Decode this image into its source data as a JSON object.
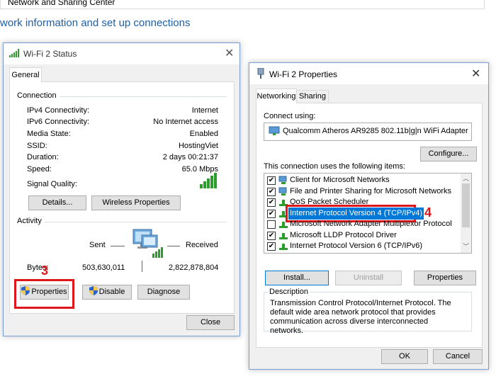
{
  "bg": {
    "breadcrumb": "Network and Sharing Center",
    "heading": "work information and set up connections"
  },
  "status_dialog": {
    "title": "Wi-Fi 2 Status",
    "tab_general": "General",
    "connection_label": "Connection",
    "rows": [
      {
        "label": "IPv4 Connectivity:",
        "value": "Internet"
      },
      {
        "label": "IPv6 Connectivity:",
        "value": "No Internet access"
      },
      {
        "label": "Media State:",
        "value": "Enabled"
      },
      {
        "label": "SSID:",
        "value": "HostingViet"
      },
      {
        "label": "Duration:",
        "value": "2 days 00:21:37"
      },
      {
        "label": "Speed:",
        "value": "65.0 Mbps"
      }
    ],
    "signal_label": "Signal Quality:",
    "details_btn": "Details...",
    "wireless_btn": "Wireless Properties",
    "activity_label": "Activity",
    "sent_label": "Sent",
    "received_label": "Received",
    "bytes_label": "Bytes:",
    "bytes_sent": "503,630,011",
    "bytes_received": "2,822,878,804",
    "properties_btn": "Properties",
    "disable_btn": "Disable",
    "diagnose_btn": "Diagnose",
    "close_btn": "Close",
    "step_marker": "3"
  },
  "props_dialog": {
    "title": "Wi-Fi 2 Properties",
    "tab_networking": "Networking",
    "tab_sharing": "Sharing",
    "connect_using_label": "Connect using:",
    "adapter": "Qualcomm Atheros AR9285 802.11b|g|n WiFi Adapter",
    "configure_btn": "Configure...",
    "items_label": "This connection uses the following items:",
    "items": [
      {
        "label": "Client for Microsoft Networks",
        "checked": true
      },
      {
        "label": "File and Printer Sharing for Microsoft Networks",
        "checked": true
      },
      {
        "label": "QoS Packet Scheduler",
        "checked": true
      },
      {
        "label": "Internet Protocol Version 4 (TCP/IPv4)",
        "checked": true,
        "selected": true
      },
      {
        "label": "Microsoft Network Adapter Multiplexor Protocol",
        "checked": false
      },
      {
        "label": "Microsoft LLDP Protocol Driver",
        "checked": true
      },
      {
        "label": "Internet Protocol Version 6 (TCP/IPv6)",
        "checked": true
      }
    ],
    "install_btn": "Install...",
    "uninstall_btn": "Uninstall",
    "properties_btn": "Properties",
    "description_label": "Description",
    "description_text": "Transmission Control Protocol/Internet Protocol. The default wide area network protocol that provides communication across diverse interconnected networks.",
    "ok_btn": "OK",
    "cancel_btn": "Cancel",
    "step_marker": "4"
  },
  "colors": {
    "accent_blue": "#1e5fa8",
    "selection": "#0078d7",
    "highlight_red": "#e0161d"
  }
}
